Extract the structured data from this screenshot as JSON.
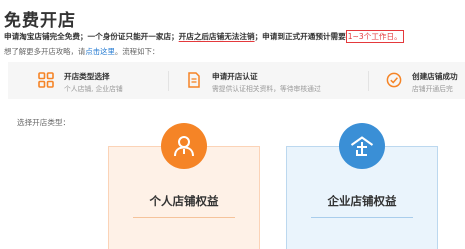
{
  "page": {
    "title": "免费开店"
  },
  "notice": {
    "part1": "申请淘宝店铺完全免费；一个身份证只能开一家店；",
    "part2": "开店之后店铺无法注销",
    "part3": "；申请到正式开通预计需要",
    "part4": "1~3个工作日。"
  },
  "help": {
    "prefix": "想了解更多开店攻略，请",
    "link": "点击这里",
    "suffix": "。流程如下："
  },
  "steps": [
    {
      "title": "开店类型选择",
      "desc": "个人店铺, 企业店铺",
      "icon": "grid-icon"
    },
    {
      "title": "申请开店认证",
      "desc": "需提供认证相关资料，等待审核通过",
      "icon": "document-icon"
    },
    {
      "title": "创建店铺成功",
      "desc": "店铺开通后完",
      "icon": "check-circle-icon"
    }
  ],
  "choose_label": "选择开店类型：",
  "cards": {
    "personal": {
      "label": "个人店铺权益",
      "icon": "person-icon",
      "color": "#f58426"
    },
    "enterprise": {
      "label": "企业店铺权益",
      "icon": "enterprise-icon",
      "color": "#3a8fd6"
    }
  }
}
